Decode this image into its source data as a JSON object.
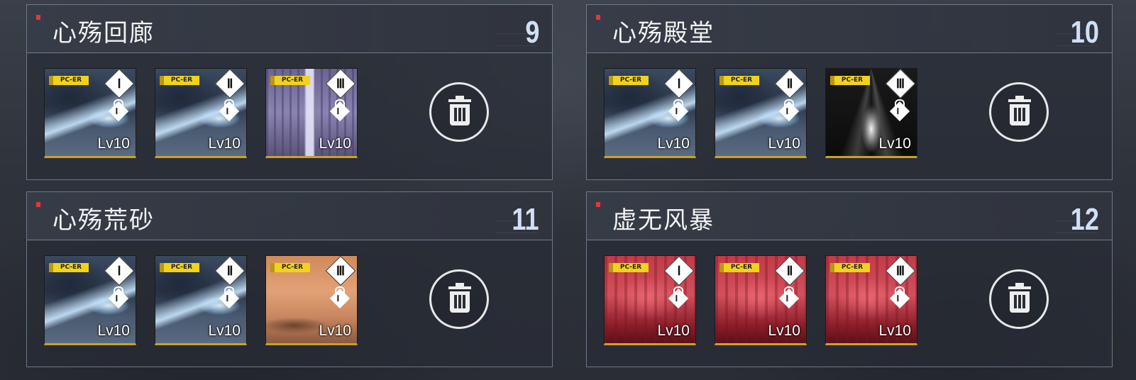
{
  "panels": [
    {
      "title": "心殇回廊",
      "number": "9",
      "cards": [
        {
          "art": "dragon",
          "tag": "PC-ER",
          "rank": "Ⅰ",
          "level": "Lv10"
        },
        {
          "art": "dragon",
          "tag": "PC-ER",
          "rank": "Ⅱ",
          "level": "Lv10"
        },
        {
          "art": "figure",
          "tag": "PC-ER",
          "rank": "Ⅲ",
          "level": "Lv10"
        }
      ]
    },
    {
      "title": "心殇殿堂",
      "number": "10",
      "cards": [
        {
          "art": "dragon",
          "tag": "PC-ER",
          "rank": "Ⅰ",
          "level": "Lv10"
        },
        {
          "art": "dragon",
          "tag": "PC-ER",
          "rank": "Ⅱ",
          "level": "Lv10"
        },
        {
          "art": "light",
          "tag": "PC-ER",
          "rank": "Ⅲ",
          "level": "Lv10"
        }
      ]
    },
    {
      "title": "心殇荒砂",
      "number": "11",
      "cards": [
        {
          "art": "dragon",
          "tag": "PC-ER",
          "rank": "Ⅰ",
          "level": "Lv10"
        },
        {
          "art": "dragon",
          "tag": "PC-ER",
          "rank": "Ⅱ",
          "level": "Lv10"
        },
        {
          "art": "sand",
          "tag": "PC-ER",
          "rank": "Ⅲ",
          "level": "Lv10"
        }
      ]
    },
    {
      "title": "虚无风暴",
      "number": "12",
      "cards": [
        {
          "art": "fire",
          "tag": "PC-ER",
          "rank": "Ⅰ",
          "level": "Lv10"
        },
        {
          "art": "fire",
          "tag": "PC-ER",
          "rank": "Ⅱ",
          "level": "Lv10"
        },
        {
          "art": "fire",
          "tag": "PC-ER",
          "rank": "Ⅲ",
          "level": "Lv10"
        }
      ]
    }
  ],
  "colors": {
    "accent_red": "#e5363d",
    "tag_yellow": "#f2d21b",
    "number_blue": "#cfe0f6"
  },
  "icons": {
    "delete": "trash-icon",
    "lock": "lock-icon"
  }
}
